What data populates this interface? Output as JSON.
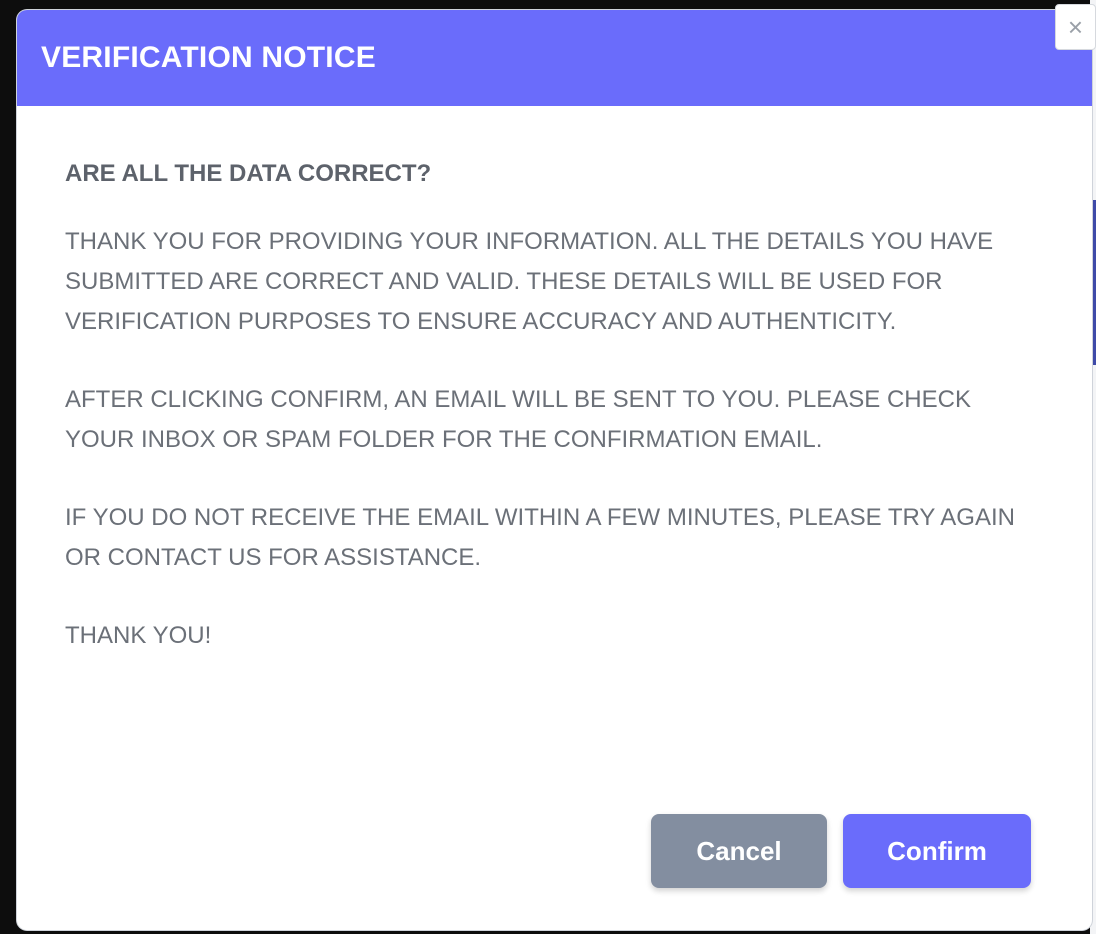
{
  "modal": {
    "title": "VERIFICATION NOTICE",
    "close_glyph": "×",
    "question": "ARE ALL THE DATA CORRECT?",
    "paragraphs": [
      "THANK YOU FOR PROVIDING YOUR INFORMATION. ALL THE DETAILS YOU HAVE SUBMITTED ARE CORRECT AND VALID. THESE DETAILS WILL BE USED FOR VERIFICATION PURPOSES TO ENSURE ACCURACY AND AUTHENTICITY.",
      "AFTER CLICKING CONFIRM, AN EMAIL WILL BE SENT TO YOU. PLEASE CHECK YOUR INBOX OR SPAM FOLDER FOR THE CONFIRMATION EMAIL.",
      "IF YOU DO NOT RECEIVE THE EMAIL WITHIN A FEW MINUTES, PLEASE TRY AGAIN OR CONTACT US FOR ASSISTANCE.",
      "THANK YOU!"
    ],
    "buttons": {
      "cancel_label": "Cancel",
      "confirm_label": "Confirm"
    }
  },
  "colors": {
    "header": "#6a6cfb",
    "confirm": "#6a6cfb",
    "cancel": "#838ea0",
    "body_text": "#6b7078"
  },
  "icons": {
    "close": "close-icon"
  }
}
